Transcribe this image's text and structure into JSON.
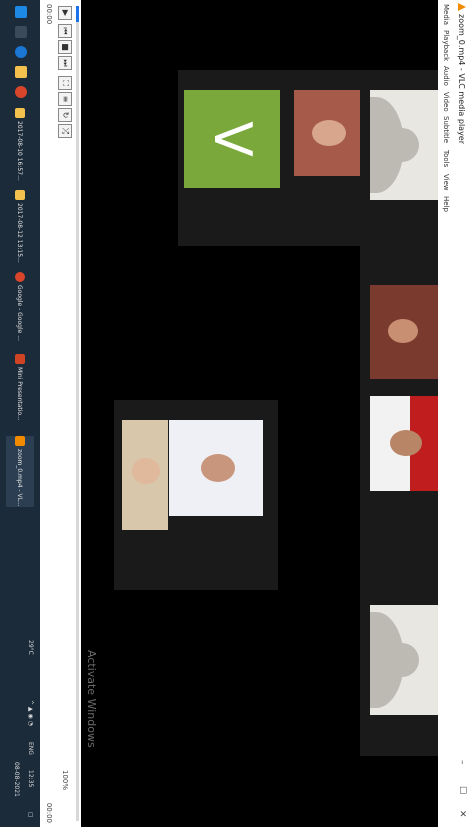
{
  "window": {
    "title": "zoom_0.mp4 - VLC media player",
    "controls": [
      "–",
      "☐",
      "✕"
    ]
  },
  "menu": [
    "Media",
    "Playback",
    "Audio",
    "Video",
    "Subtitle",
    "Tools",
    "View",
    "Help"
  ],
  "video": {
    "watermark": "Activate Windows",
    "initial": "V"
  },
  "player": {
    "progress": 0.02,
    "time_elapsed": "00:00",
    "time_total": "00:00",
    "volume": "100%"
  },
  "taskbar": {
    "items": [
      {
        "label": "2017-08-10 16:57...",
        "icon": "folder-icon"
      },
      {
        "label": "2017-08-12 13:15...",
        "icon": "folder-icon"
      },
      {
        "label": "Google - Google ...",
        "icon": "chrome-icon"
      },
      {
        "label": "Mini Presentatio...",
        "icon": "presentation-icon"
      },
      {
        "label": "zoom_0.mp4 - VL...",
        "icon": "vlc-icon"
      }
    ],
    "weather": "29°C",
    "lang": "ENG",
    "time": "12:35",
    "date": "08-08-2021"
  }
}
